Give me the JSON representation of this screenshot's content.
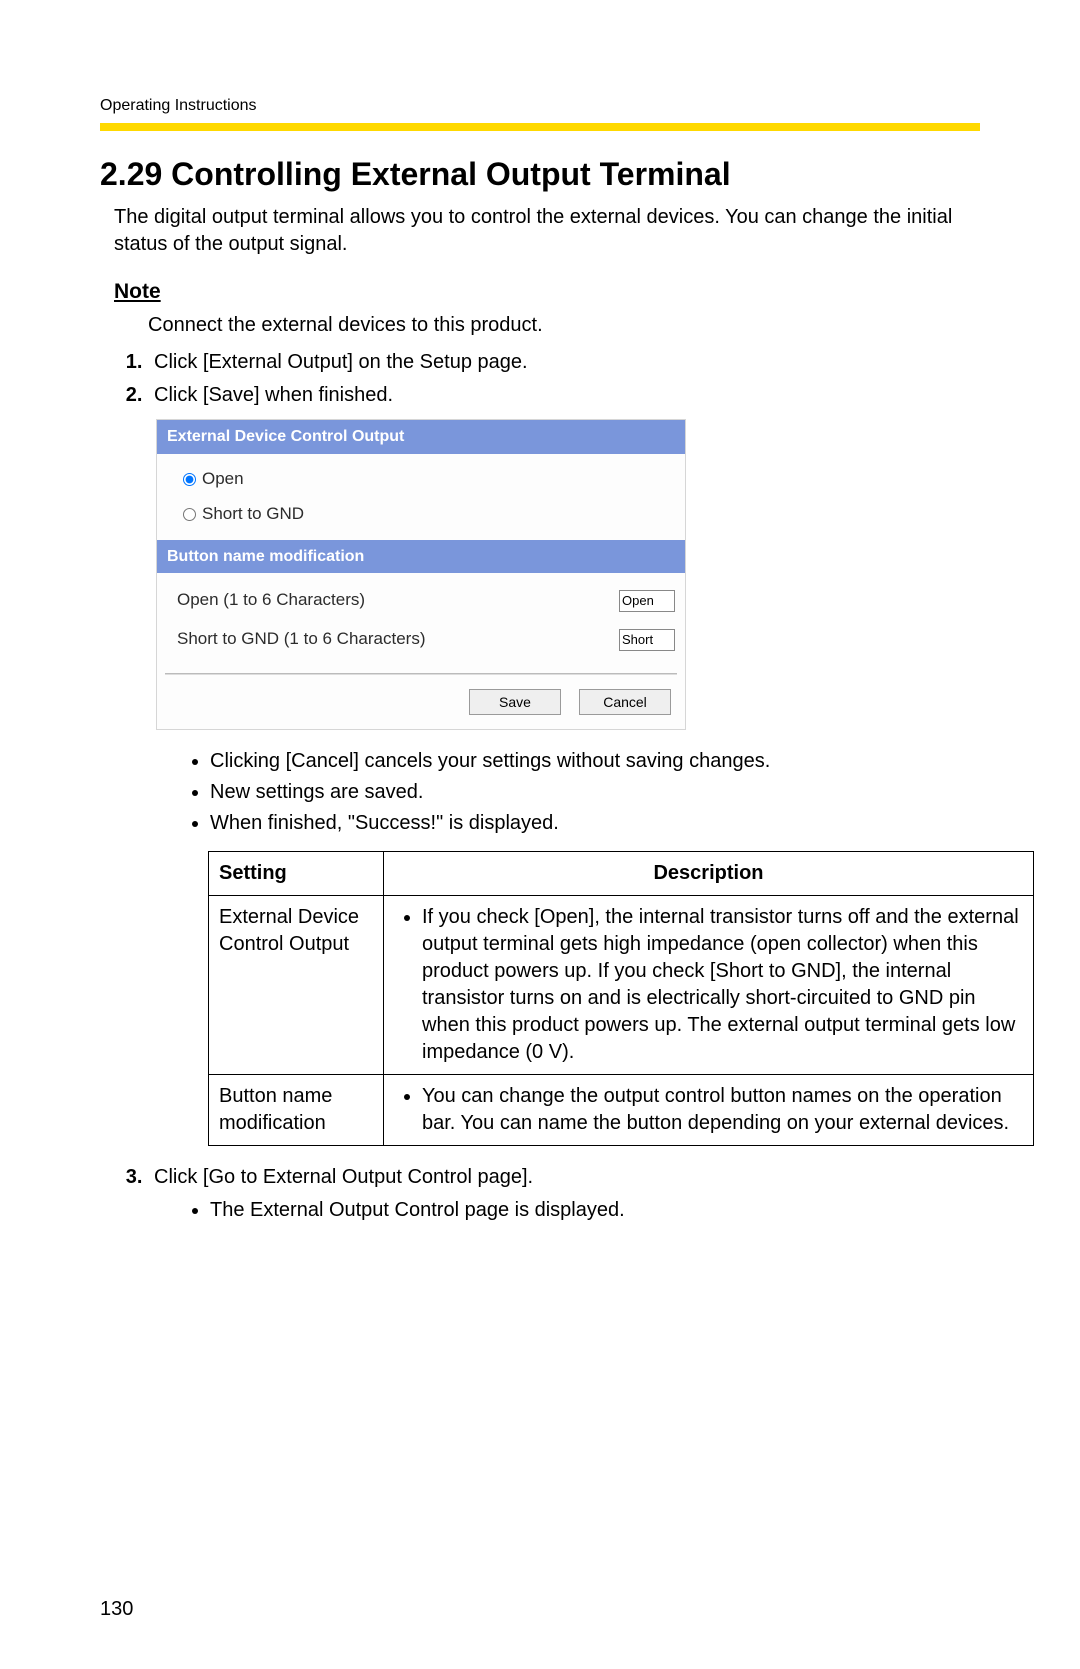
{
  "header": {
    "running": "Operating Instructions"
  },
  "title": "2.29  Controlling External Output Terminal",
  "intro": "The digital output terminal allows you to control the external devices. You can change the initial status of the output signal.",
  "note": {
    "heading": "Note",
    "text": "Connect the external devices to this product."
  },
  "steps": {
    "s1": "Click [External Output] on the Setup page.",
    "s2": "Click [Save] when finished.",
    "s3": "Click [Go to External Output Control page]."
  },
  "dialog": {
    "header1": "External Device Control Output",
    "radio_open": "Open",
    "radio_short": "Short to GND",
    "header2": "Button name modification",
    "label_open": "Open (1 to 6 Characters)",
    "value_open": "Open",
    "label_short": "Short to GND (1 to 6 Characters)",
    "value_short": "Short",
    "btn_save": "Save",
    "btn_cancel": "Cancel"
  },
  "bullets_after_dialog": {
    "b1": "Clicking [Cancel] cancels your settings without saving changes.",
    "b2": "New settings are saved.",
    "b3": "When finished, \"Success!\" is displayed."
  },
  "table": {
    "col1": "Setting",
    "col2": "Description",
    "row1": {
      "setting": "External Device Control Output",
      "desc": "If you check [Open], the internal transistor turns off and the external output terminal gets high impedance (open collector) when this product powers up. If you check [Short to GND], the internal transistor turns on and is electrically short-circuited to GND pin when this product powers up. The external output terminal gets low impedance (0 V)."
    },
    "row2": {
      "setting": "Button name modification",
      "desc": "You can change the output control button names on the operation bar. You can name the button depending on your external devices."
    }
  },
  "bullets_after_step3": {
    "b1": "The External Output Control page is displayed."
  },
  "page_number": "130"
}
